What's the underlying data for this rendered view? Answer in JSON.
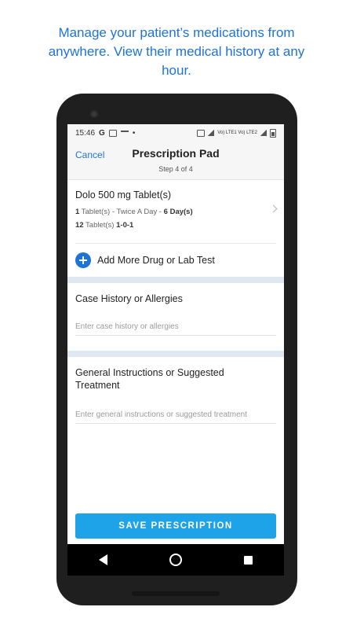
{
  "promo": {
    "line1": "Manage your patient’s medications from",
    "line2": "anywhere. View their medical history at any",
    "line3": "hour."
  },
  "status_bar": {
    "time": "15:46",
    "carrier_glyph": "G",
    "right_labels": "Vo) LTE1 Vo) LTE2"
  },
  "header": {
    "cancel_label": "Cancel",
    "title": "Prescription Pad",
    "step": "Step 4 of 4"
  },
  "drug": {
    "name": "Dolo 500 mg Tablet(s)",
    "qty": "1",
    "unit": "Tablet(s) - Twice A Day - ",
    "duration": "6 Day(s)",
    "total": "12",
    "total_unit": "Tablet(s) ",
    "schedule": "1-0-1"
  },
  "add_more": {
    "label": "Add More Drug or Lab Test"
  },
  "case_history": {
    "title": "Case History or Allergies",
    "placeholder": "Enter case history or allergies"
  },
  "instructions": {
    "title_line1": "General Instructions or Suggested",
    "title_line2": "Treatment",
    "placeholder": "Enter general instructions or suggested treatment"
  },
  "save": {
    "label": "SAVE PRESCRIPTION"
  },
  "icons": {
    "back": "back-triangle-icon",
    "home": "home-circle-icon",
    "recent": "recent-square-icon",
    "add": "plus-circle-icon",
    "chevron": "chevron-right-icon"
  },
  "colors": {
    "accent": "#1e73d8",
    "save_button": "#1ea2e8",
    "section_band": "#dfe8f0"
  }
}
